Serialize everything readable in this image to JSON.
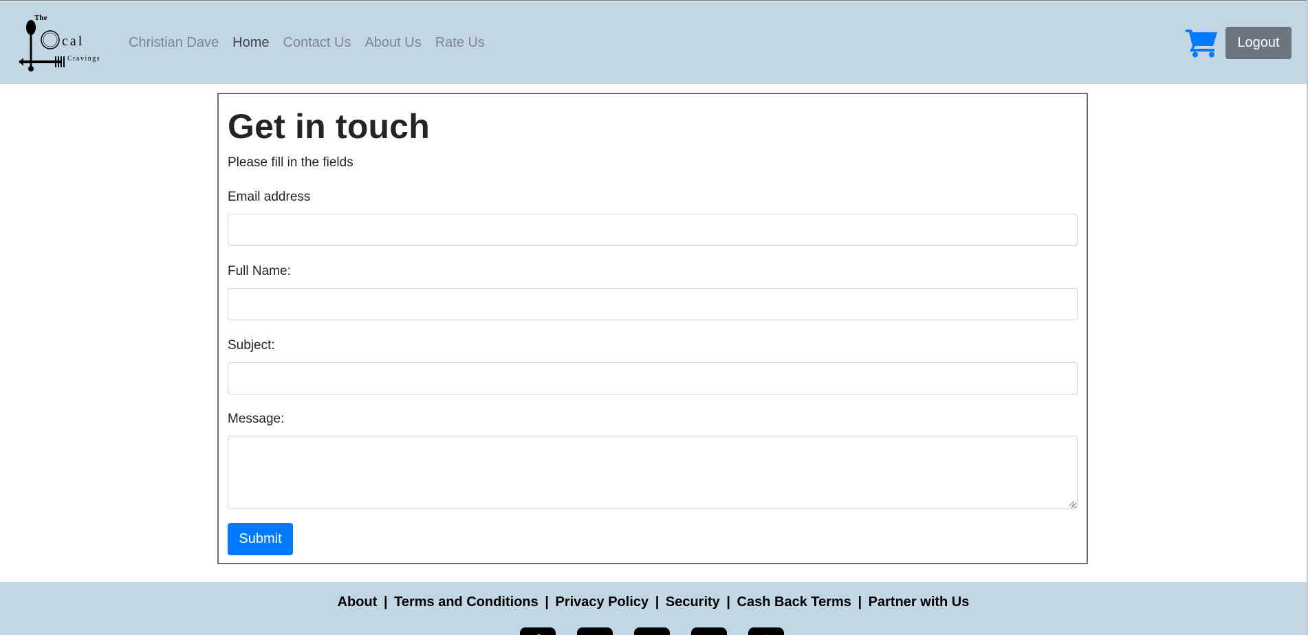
{
  "navbar": {
    "logo": {
      "line1": "The",
      "line2": "cal",
      "line3": "Cravings"
    },
    "links": [
      {
        "label": "Christian Dave",
        "active": false
      },
      {
        "label": "Home",
        "active": true
      },
      {
        "label": "Contact Us",
        "active": false
      },
      {
        "label": "About Us",
        "active": false
      },
      {
        "label": "Rate Us",
        "active": false
      }
    ],
    "cart_icon": "shopping-cart-icon",
    "logout_label": "Logout"
  },
  "form": {
    "title": "Get in touch",
    "subtitle": "Please fill in the fields",
    "email_label": "Email address",
    "email_value": "",
    "fullname_label": "Full Name:",
    "fullname_value": "",
    "subject_label": "Subject:",
    "subject_value": "",
    "message_label": "Message:",
    "message_value": "",
    "submit_label": "Submit"
  },
  "footer": {
    "links": [
      "About",
      "Terms and Conditions",
      "Privacy Policy",
      "Security",
      "Cash Back Terms",
      "Partner with Us"
    ],
    "separator": "|",
    "social_icons": [
      "facebook-icon",
      "instagram-icon",
      "twitter-icon",
      "youtube-icon",
      "pinterest-icon"
    ]
  },
  "colors": {
    "navbar_bg": "#c2d6e3",
    "primary": "#007bff",
    "secondary": "#6c757d"
  }
}
